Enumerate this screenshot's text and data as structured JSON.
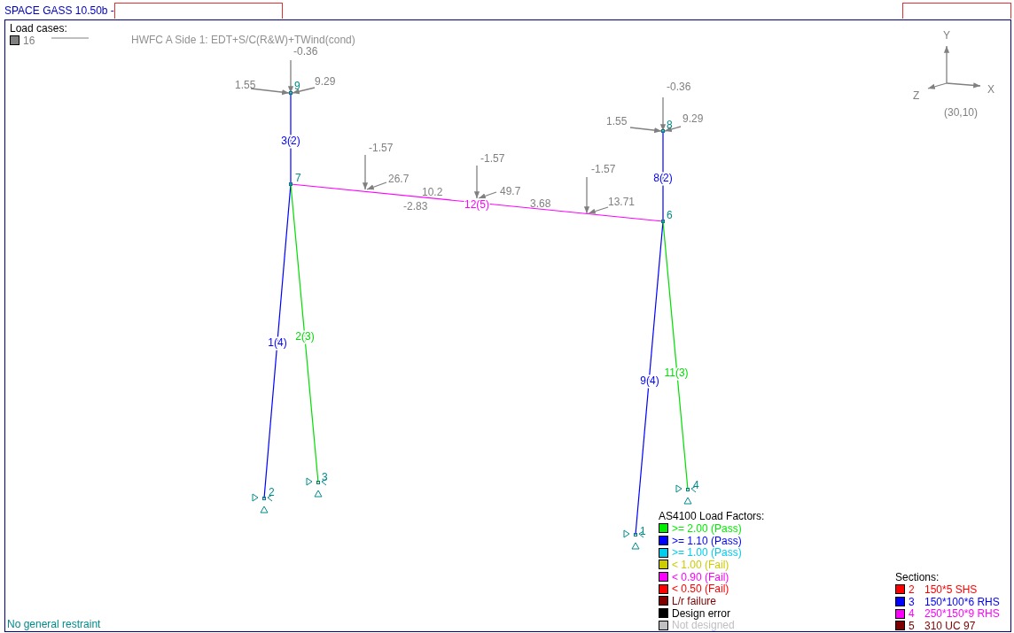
{
  "window": {
    "title": "SPACE GASS 10.50b -"
  },
  "load_cases": {
    "heading": "Load cases:",
    "number": "16",
    "color": "#808080",
    "description": "HWFC A Side 1: EDT+S/C(R&W)+TWind(cond)"
  },
  "nodes": [
    {
      "label": "9"
    },
    {
      "label": "7"
    },
    {
      "label": "8"
    },
    {
      "label": "6"
    },
    {
      "label": "2"
    },
    {
      "label": "3"
    },
    {
      "label": "1"
    },
    {
      "label": "4"
    }
  ],
  "members": [
    {
      "label": "3(2)",
      "color": "#0000ff"
    },
    {
      "label": "8(2)",
      "color": "#0000ff"
    },
    {
      "label": "12(5)",
      "color": "#ff00ff"
    },
    {
      "label": "1(4)",
      "color": "#0000ff"
    },
    {
      "label": "2(3)",
      "color": "#00dd00"
    },
    {
      "label": "9(4)",
      "color": "#0000ff"
    },
    {
      "label": "11(3)",
      "color": "#00dd00"
    }
  ],
  "loads": [
    {
      "value": "-0.36"
    },
    {
      "value": "1.55"
    },
    {
      "value": "9.29"
    },
    {
      "value": "-0.36"
    },
    {
      "value": "1.55"
    },
    {
      "value": "9.29"
    },
    {
      "value": "-1.57"
    },
    {
      "value": "26.7"
    },
    {
      "value": "-1.57"
    },
    {
      "value": "49.7"
    },
    {
      "value": "-1.57"
    },
    {
      "value": "13.71"
    }
  ],
  "beam_values": [
    "10.2",
    "-2.83",
    "3.68"
  ],
  "axes": {
    "y": "Y",
    "x": "X",
    "z": "Z",
    "view": "(30,10)"
  },
  "load_factors": {
    "title": "AS4100 Load Factors:",
    "items": [
      {
        "label": ">= 2.00 (Pass)",
        "color": "#00ee00"
      },
      {
        "label": ">= 1.10 (Pass)",
        "color": "#0000ff"
      },
      {
        "label": ">= 1.00 (Pass)",
        "color": "#00ccee"
      },
      {
        "label": "< 1.00 (Fail)",
        "color": "#cccc00"
      },
      {
        "label": "< 0.90 (Fail)",
        "color": "#ff00ff"
      },
      {
        "label": "< 0.50 (Fail)",
        "color": "#ff0000"
      },
      {
        "label": "L/r failure",
        "color": "#800000"
      },
      {
        "label": "Design error",
        "color": "#000000"
      },
      {
        "label": "Not designed",
        "color": "#c0c0c0"
      }
    ]
  },
  "sections": {
    "title": "Sections:",
    "items": [
      {
        "number": "2",
        "name": "150*5 SHS",
        "color": "#ff0000"
      },
      {
        "number": "3",
        "name": "150*100*6 RHS",
        "color": "#0000ff"
      },
      {
        "number": "4",
        "name": "250*150*9 RHS",
        "color": "#ff00ff"
      },
      {
        "number": "5",
        "name": "310 UC 97",
        "color": "#800000"
      }
    ]
  },
  "status": "No general restraint"
}
